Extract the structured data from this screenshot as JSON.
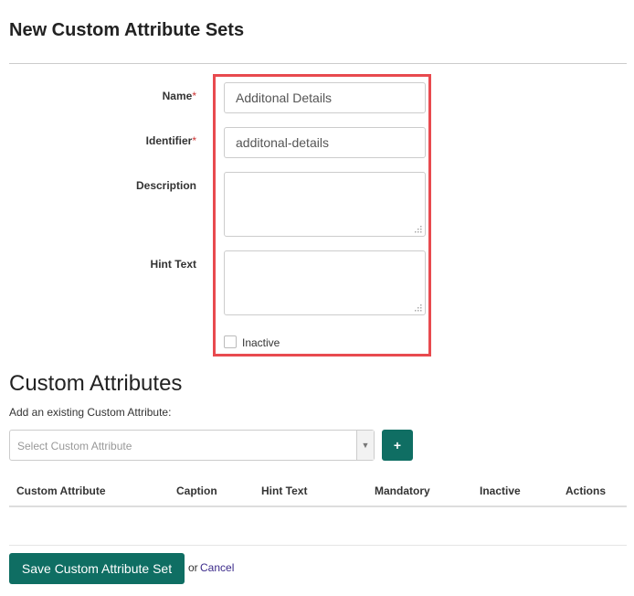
{
  "page": {
    "title": "New Custom Attribute Sets"
  },
  "form": {
    "name": {
      "label": "Name",
      "required_mark": "*",
      "value": "Additonal Details"
    },
    "identifier": {
      "label": "Identifier",
      "required_mark": "*",
      "value": "additonal-details"
    },
    "description": {
      "label": "Description",
      "value": ""
    },
    "hint_text": {
      "label": "Hint Text",
      "value": ""
    },
    "inactive": {
      "label": "Inactive",
      "checked": false
    }
  },
  "custom_attributes": {
    "title": "Custom Attributes",
    "help": "Add an existing Custom Attribute:",
    "select_placeholder": "Select Custom Attribute",
    "add_button": "+",
    "columns": [
      "Custom Attribute",
      "Caption",
      "Hint Text",
      "Mandatory",
      "Inactive",
      "Actions"
    ],
    "rows": []
  },
  "footer": {
    "save_label": "Save Custom Attribute Set",
    "or_text": "or",
    "cancel_label": "Cancel"
  },
  "colors": {
    "primary": "#0f6e63",
    "highlight": "#e84a4f",
    "required": "#cc3333",
    "link": "#3b2a8a"
  }
}
